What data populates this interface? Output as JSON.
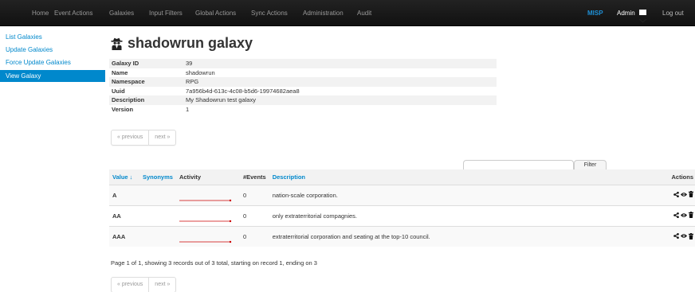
{
  "navbar": {
    "items": [
      "Home",
      "Event Actions",
      "Galaxies",
      "Input Filters",
      "Global Actions",
      "Sync Actions",
      "Administration",
      "Audit"
    ],
    "brand": "MISP",
    "user": "Admin",
    "logout": "Log out"
  },
  "sidebar": {
    "items": [
      "List Galaxies",
      "Update Galaxies",
      "Force Update Galaxies",
      "View Galaxy"
    ],
    "active_index": 3
  },
  "page": {
    "title": "shadowrun galaxy",
    "icon": "user-secret-icon"
  },
  "meta": [
    {
      "key": "Galaxy ID",
      "value": "39"
    },
    {
      "key": "Name",
      "value": "shadowrun"
    },
    {
      "key": "Namespace",
      "value": "RPG"
    },
    {
      "key": "Uuid",
      "value": "7a956b4d-613c-4c08-b5d6-19974682aea8"
    },
    {
      "key": "Description",
      "value": "My Shadowrun test galaxy"
    },
    {
      "key": "Version",
      "value": "1"
    }
  ],
  "pagination": {
    "previous": "« previous",
    "next": "next »"
  },
  "filter": {
    "button": "Filter",
    "value": ""
  },
  "table": {
    "headers": {
      "value": "Value ↓",
      "synonyms": "Synonyms",
      "activity": "Activity",
      "events": "#Events",
      "description": "Description",
      "actions": "Actions"
    },
    "rows": [
      {
        "value": "A",
        "synonyms": "",
        "events": "0",
        "description": "nation-scale corporation."
      },
      {
        "value": "AA",
        "synonyms": "",
        "events": "0",
        "description": "only extraterritorial compagnies."
      },
      {
        "value": "AAA",
        "synonyms": "",
        "events": "0",
        "description": "extraterritorial corporation and seating at the top-10 council."
      }
    ]
  },
  "summary": "Page 1 of 1, showing 3 records out of 3 total, starting on record 1, ending on 3",
  "colors": {
    "accent": "#0088cc",
    "navbar": "#1b1b1b",
    "brand": "#1e90d6",
    "spark_line": "#cc0000"
  }
}
